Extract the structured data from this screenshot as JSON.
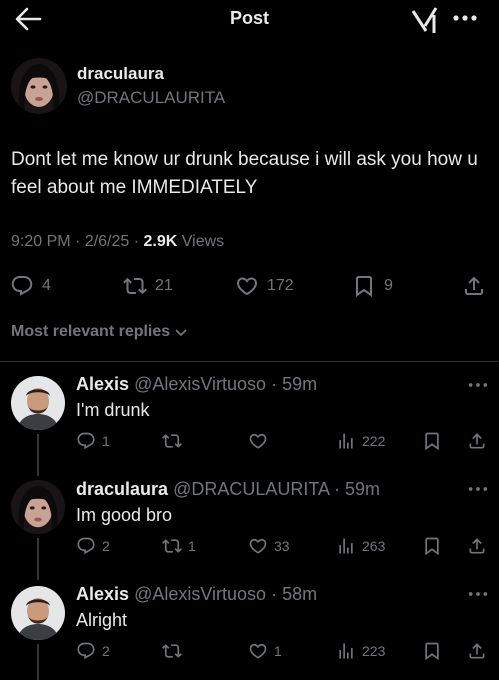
{
  "header": {
    "title": "Post",
    "back_icon": "arrow-left-icon",
    "grok_icon": "grok-icon",
    "more_icon": "more-dots-icon"
  },
  "post": {
    "display_name": "draculaura",
    "handle": "@DRACULAURITA",
    "text": "Dont let me know ur drunk because i will ask you how u feel about me IMMEDIATELY",
    "time": "9:20 PM",
    "date": "2/6/25",
    "views": "2.9K",
    "views_label": "Views",
    "stats": {
      "replies": "4",
      "reposts": "21",
      "likes": "172",
      "bookmarks": "9"
    }
  },
  "replies_filter": "Most relevant replies",
  "replies": [
    {
      "name": "Alexis",
      "handle": "@AlexisVirtuoso",
      "age": "59m",
      "text": "I'm drunk",
      "replies": "1",
      "reposts": "",
      "likes": "",
      "views": "222"
    },
    {
      "name": "draculaura",
      "handle": "@DRACULAURITA",
      "age": "59m",
      "text": "Im good bro",
      "replies": "2",
      "reposts": "1",
      "likes": "33",
      "views": "263"
    },
    {
      "name": "Alexis",
      "handle": "@AlexisVirtuoso",
      "age": "58m",
      "text": "Alright",
      "replies": "2",
      "reposts": "",
      "likes": "1",
      "views": "223"
    }
  ],
  "colors": {
    "background": "#000000",
    "text": "#e7e9ea",
    "muted": "#71767b",
    "divider": "#2f3336"
  }
}
